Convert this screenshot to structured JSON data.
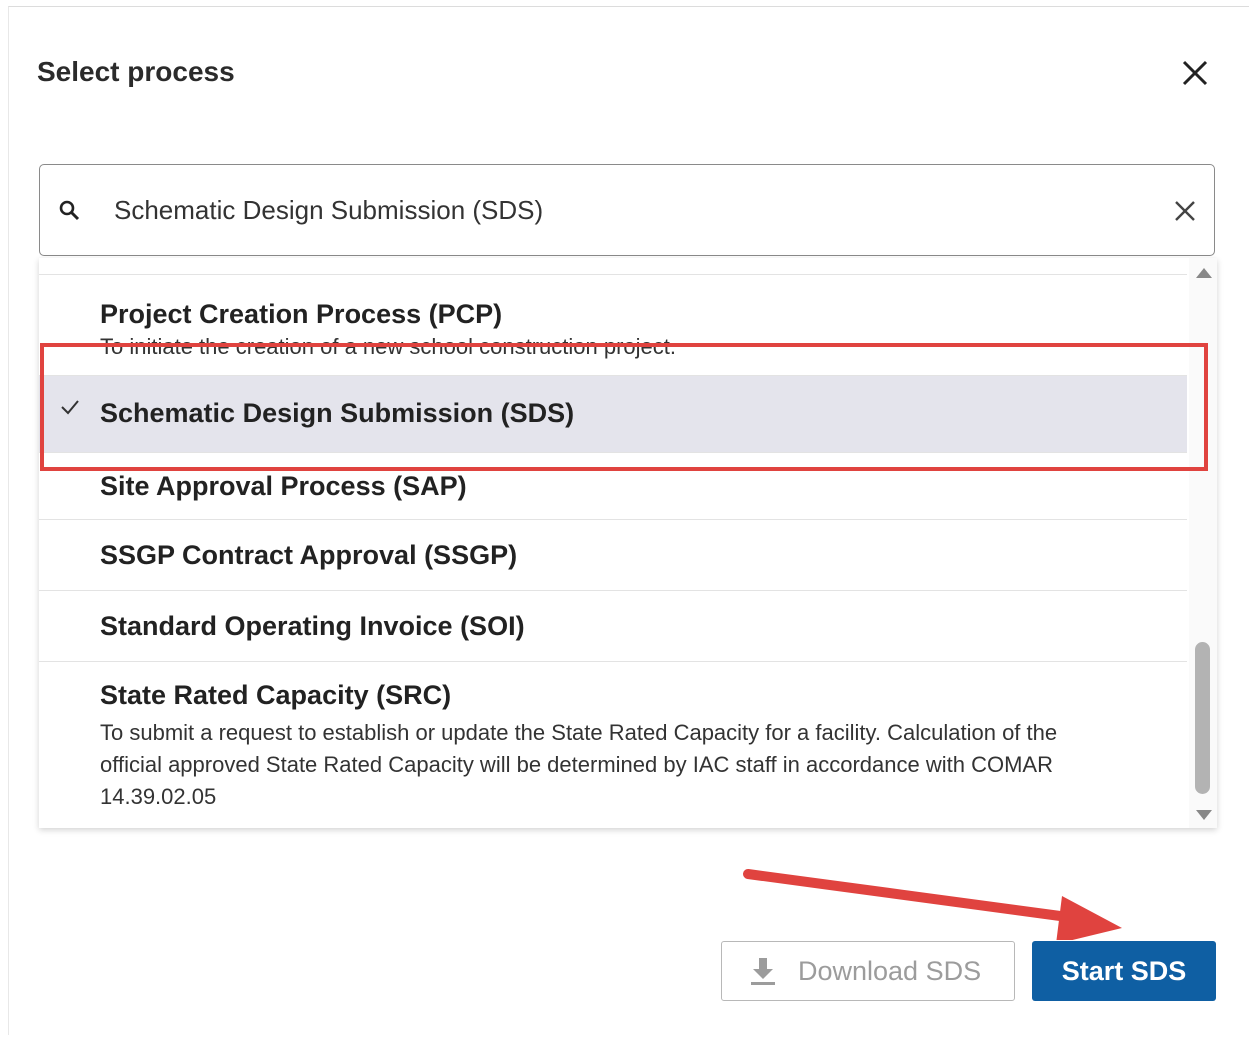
{
  "dialog": {
    "title": "Select process"
  },
  "search": {
    "value": "Schematic Design Submission (SDS)"
  },
  "list": {
    "items": [
      {
        "title": "Project Creation Process (PCP)",
        "description": "To initiate the creation of a new school construction project."
      },
      {
        "title": "Schematic Design Submission (SDS)",
        "selected": true
      },
      {
        "title": "Site Approval Process (SAP)"
      },
      {
        "title": "SSGP Contract Approval (SSGP)"
      },
      {
        "title": "Standard Operating Invoice (SOI)"
      },
      {
        "title": "State Rated Capacity (SRC)",
        "description": "To submit a request to establish or update the State Rated Capacity for a facility. Calculation of the official approved State Rated Capacity will be determined by IAC staff in accordance with COMAR 14.39.02.05"
      }
    ]
  },
  "footer": {
    "download_label": "Download SDS",
    "start_label": "Start SDS"
  },
  "colors": {
    "primary": "#0f5fa3",
    "selected_bg": "#e4e4ec",
    "annotation": "#e0433f"
  }
}
